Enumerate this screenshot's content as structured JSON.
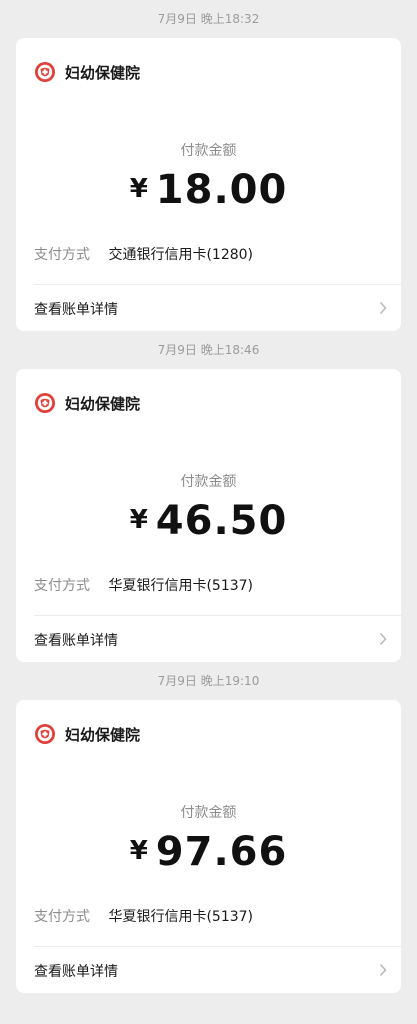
{
  "payments": [
    {
      "timestamp": "7月9日 晚上18:32",
      "merchant": {
        "name": "妇幼保健院",
        "icon": "hospital-logo-icon"
      },
      "amount_label": "付款金额",
      "currency_symbol": "¥",
      "amount": "18.00",
      "payment_method_label": "支付方式",
      "payment_method_value": "交通银行信用卡(1280)",
      "details_label": "查看账单详情"
    },
    {
      "timestamp": "7月9日 晚上18:46",
      "merchant": {
        "name": "妇幼保健院",
        "icon": "hospital-logo-icon"
      },
      "amount_label": "付款金额",
      "currency_symbol": "¥",
      "amount": "46.50",
      "payment_method_label": "支付方式",
      "payment_method_value": "华夏银行信用卡(5137)",
      "details_label": "查看账单详情"
    },
    {
      "timestamp": "7月9日 晚上19:10",
      "merchant": {
        "name": "妇幼保健院",
        "icon": "hospital-logo-icon"
      },
      "amount_label": "付款金额",
      "currency_symbol": "¥",
      "amount": "97.66",
      "payment_method_label": "支付方式",
      "payment_method_value": "华夏银行信用卡(5137)",
      "details_label": "查看账单详情"
    }
  ],
  "colors": {
    "background": "#ededed",
    "card": "#ffffff",
    "logo_red": "#e0403a",
    "secondary_text": "#8c8c8c"
  }
}
